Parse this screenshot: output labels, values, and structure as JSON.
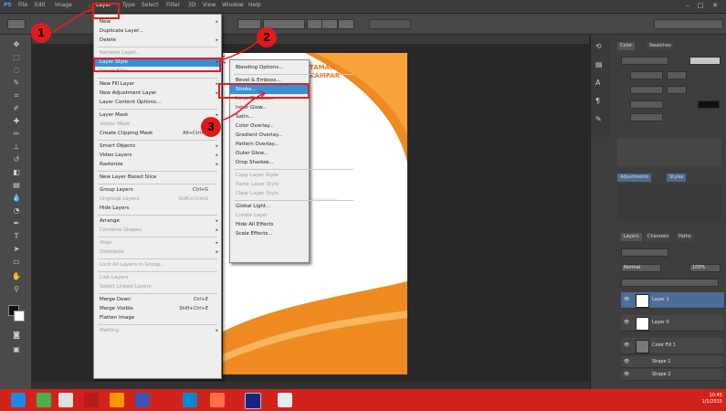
{
  "menubar": {
    "items": [
      "PS",
      "File",
      "Edit",
      "Image",
      "Layer",
      "Type",
      "Select",
      "Filter",
      "3D",
      "View",
      "Window",
      "Help"
    ],
    "window_controls": [
      "–",
      "□",
      "✕"
    ]
  },
  "layer_menu": {
    "items": [
      {
        "label": "New",
        "shortcut": "",
        "submenu": true,
        "disabled": false
      },
      {
        "label": "Duplicate Layer...",
        "shortcut": "",
        "submenu": false,
        "disabled": false
      },
      {
        "label": "Delete",
        "shortcut": "",
        "submenu": true,
        "disabled": false
      },
      {
        "sep": true
      },
      {
        "label": "Rename Layer...",
        "shortcut": "",
        "submenu": false,
        "disabled": true
      },
      {
        "label": "Layer Style",
        "shortcut": "",
        "submenu": true,
        "disabled": false,
        "highlighted": true
      },
      {
        "label": "Smart Filter",
        "shortcut": "",
        "submenu": true,
        "disabled": true
      },
      {
        "sep": true
      },
      {
        "label": "New Fill Layer",
        "shortcut": "",
        "submenu": true,
        "disabled": false
      },
      {
        "label": "New Adjustment Layer",
        "shortcut": "",
        "submenu": true,
        "disabled": false
      },
      {
        "label": "Layer Content Options...",
        "shortcut": "",
        "submenu": false,
        "disabled": false
      },
      {
        "sep": true
      },
      {
        "label": "Layer Mask",
        "shortcut": "",
        "submenu": true,
        "disabled": false
      },
      {
        "label": "Vector Mask",
        "shortcut": "",
        "submenu": true,
        "disabled": true
      },
      {
        "label": "Create Clipping Mask",
        "shortcut": "Alt+Ctrl+G",
        "submenu": false,
        "disabled": false
      },
      {
        "sep": true
      },
      {
        "label": "Smart Objects",
        "shortcut": "",
        "submenu": true,
        "disabled": false
      },
      {
        "label": "Video Layers",
        "shortcut": "",
        "submenu": true,
        "disabled": false
      },
      {
        "label": "Rasterize",
        "shortcut": "",
        "submenu": true,
        "disabled": false
      },
      {
        "sep": true
      },
      {
        "label": "New Layer Based Slice",
        "shortcut": "",
        "submenu": false,
        "disabled": false
      },
      {
        "sep": true
      },
      {
        "label": "Group Layers",
        "shortcut": "Ctrl+G",
        "submenu": false,
        "disabled": false
      },
      {
        "label": "Ungroup Layers",
        "shortcut": "Shift+Ctrl+G",
        "submenu": false,
        "disabled": true
      },
      {
        "label": "Hide Layers",
        "shortcut": "",
        "submenu": false,
        "disabled": false
      },
      {
        "sep": true
      },
      {
        "label": "Arrange",
        "shortcut": "",
        "submenu": true,
        "disabled": false
      },
      {
        "label": "Combine Shapes",
        "shortcut": "",
        "submenu": true,
        "disabled": true
      },
      {
        "sep": true
      },
      {
        "label": "Align",
        "shortcut": "",
        "submenu": true,
        "disabled": true
      },
      {
        "label": "Distribute",
        "shortcut": "",
        "submenu": true,
        "disabled": true
      },
      {
        "sep": true
      },
      {
        "label": "Lock All Layers in Group...",
        "shortcut": "",
        "submenu": false,
        "disabled": true
      },
      {
        "sep": true
      },
      {
        "label": "Link Layers",
        "shortcut": "",
        "submenu": false,
        "disabled": true
      },
      {
        "label": "Select Linked Layers",
        "shortcut": "",
        "submenu": false,
        "disabled": true
      },
      {
        "sep": true
      },
      {
        "label": "Merge Down",
        "shortcut": "Ctrl+E",
        "submenu": false,
        "disabled": false
      },
      {
        "label": "Merge Visible",
        "shortcut": "Shift+Ctrl+E",
        "submenu": false,
        "disabled": false
      },
      {
        "label": "Flatten Image",
        "shortcut": "",
        "submenu": false,
        "disabled": false
      },
      {
        "sep": true
      },
      {
        "label": "Matting",
        "shortcut": "",
        "submenu": true,
        "disabled": true
      }
    ]
  },
  "layer_style_submenu": {
    "items": [
      {
        "label": "Blending Options...",
        "disabled": false
      },
      {
        "sep": true
      },
      {
        "label": "Bevel & Emboss...",
        "disabled": false
      },
      {
        "label": "Stroke...",
        "disabled": false,
        "highlighted": true
      },
      {
        "label": "Inner Shadow...",
        "disabled": false
      },
      {
        "label": "Inner Glow...",
        "disabled": false
      },
      {
        "label": "Satin...",
        "disabled": false
      },
      {
        "label": "Color Overlay...",
        "disabled": false
      },
      {
        "label": "Gradient Overlay...",
        "disabled": false
      },
      {
        "label": "Pattern Overlay...",
        "disabled": false
      },
      {
        "label": "Outer Glow...",
        "disabled": false
      },
      {
        "label": "Drop Shadow...",
        "disabled": false
      },
      {
        "sep": true
      },
      {
        "label": "Copy Layer Style",
        "disabled": true
      },
      {
        "label": "Paste Layer Style",
        "disabled": true
      },
      {
        "label": "Clear Layer Style",
        "disabled": true
      },
      {
        "sep": true
      },
      {
        "label": "Global Light...",
        "disabled": false
      },
      {
        "label": "Create Layer",
        "disabled": true
      },
      {
        "label": "Hide All Effects",
        "disabled": false
      },
      {
        "label": "Scale Effects...",
        "disabled": false
      }
    ]
  },
  "document": {
    "title_line1": "TAMAN",
    "title_line2": "KAMPAR"
  },
  "right_panel": {
    "tabs": [
      "Color",
      "Swatches"
    ],
    "adjust_tabs": [
      "Adjustments",
      "Styles"
    ],
    "layers_tabs": [
      "Layers",
      "Channels",
      "Paths"
    ],
    "blend_mode": "Normal",
    "opacity": "100%",
    "layers": [
      {
        "name": "Layer 1",
        "selected": true
      },
      {
        "name": "Layer 0",
        "selected": false
      },
      {
        "name": "Color Fill 1",
        "selected": false
      },
      {
        "name": "Shape 1",
        "selected": false
      },
      {
        "name": "Shape 2",
        "selected": false
      }
    ]
  },
  "annotations": {
    "badge1": "1",
    "badge2": "2",
    "badge3": "3"
  },
  "taskbar": {
    "time": "10:45",
    "date": "1/1/2015"
  }
}
